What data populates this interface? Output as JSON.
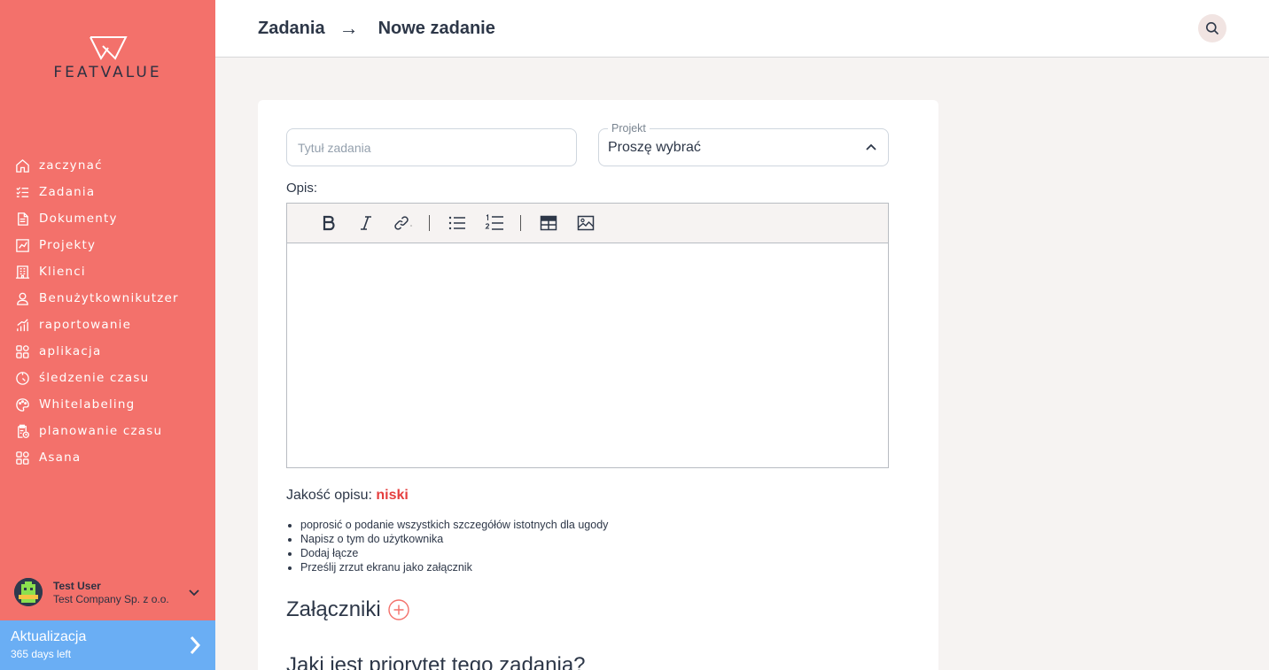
{
  "brand": {
    "name": "FEATVALUE"
  },
  "sidebar": {
    "items": [
      {
        "label": "zaczynać",
        "icon": "home-icon"
      },
      {
        "label": "Zadania",
        "icon": "tasks-icon"
      },
      {
        "label": "Dokumenty",
        "icon": "documents-icon"
      },
      {
        "label": "Projekty",
        "icon": "projects-icon"
      },
      {
        "label": "Klienci",
        "icon": "clients-icon"
      },
      {
        "label": "Benużytkownikutzer",
        "icon": "user-icon"
      },
      {
        "label": "raportowanie",
        "icon": "reporting-icon"
      },
      {
        "label": "aplikacja",
        "icon": "apps-icon"
      },
      {
        "label": "śledzenie czasu",
        "icon": "timer-icon"
      },
      {
        "label": "Whitelabeling",
        "icon": "palette-icon"
      },
      {
        "label": "planowanie czasu",
        "icon": "planning-icon"
      },
      {
        "label": "Asana",
        "icon": "apps-icon"
      }
    ],
    "user": {
      "name": "Test User",
      "company": "Test Company Sp. z o.o."
    },
    "upgrade": {
      "title": "Aktualizacja",
      "subtitle": "365 days left"
    }
  },
  "header": {
    "breadcrumb_parent": "Zadania",
    "breadcrumb_arrow": "→",
    "breadcrumb_current": "Nowe zadanie"
  },
  "form": {
    "title_placeholder": "Tytuł zadania",
    "title_value": "",
    "project_label": "Projekt",
    "project_value": "Proszę wybrać",
    "description_label": "Opis:",
    "quality_label": "Jakość opisu:",
    "quality_value": "niski",
    "tips": [
      "poprosić o podanie wszystkich szczegółów istotnych dla ugody",
      "Napisz o tym do użytkownika",
      "Dodaj łącze",
      "Prześlij zrzut ekranu jako załącznik"
    ],
    "attachments_title": "Załączniki",
    "priority_title": "Jaki jest priorytet tego zadania?"
  },
  "colors": {
    "sidebar": "#f3716b",
    "upgrade": "#6aaef4",
    "danger": "#e53e3e",
    "text": "#2d3748"
  }
}
